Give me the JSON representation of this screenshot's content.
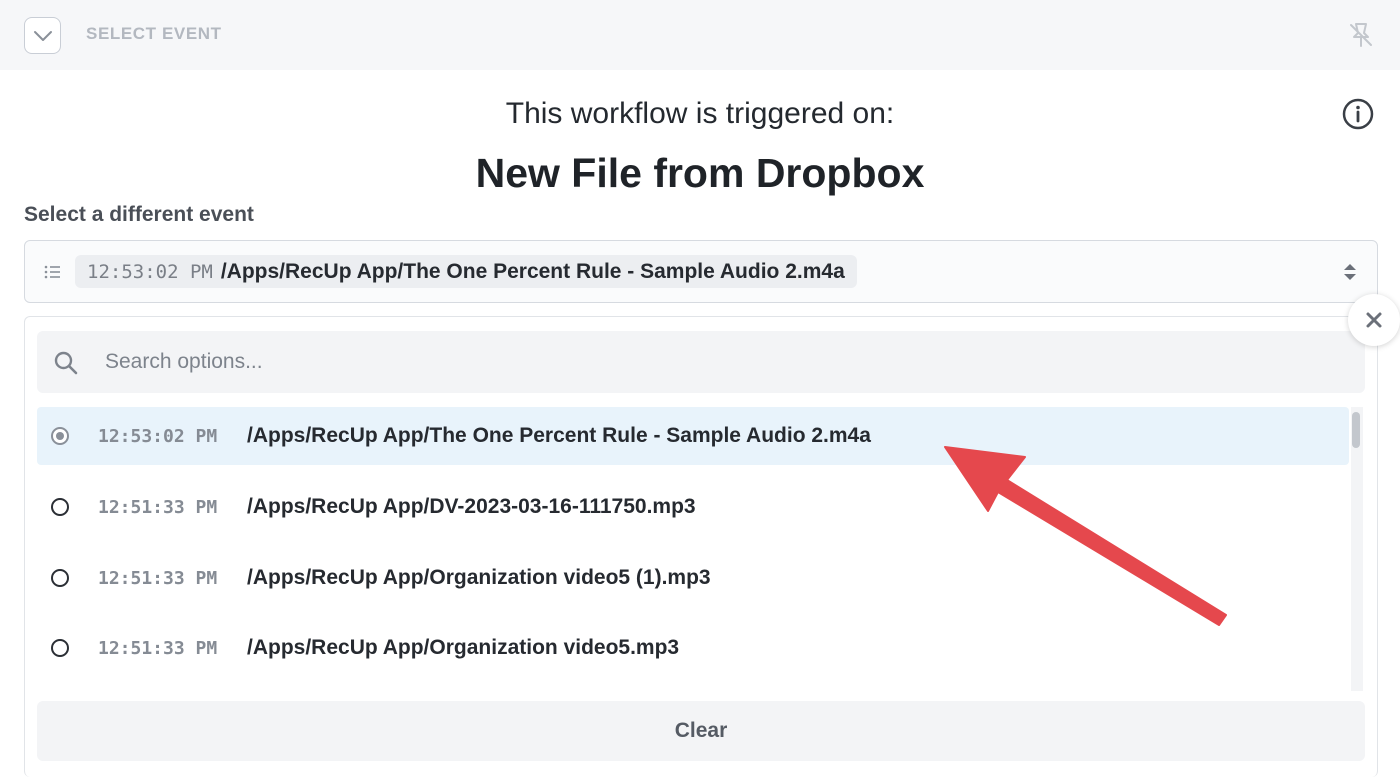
{
  "topbar": {
    "title": "SELECT EVENT",
    "collapse_icon": "chevron-down-icon",
    "pin_icon": "unpin-icon"
  },
  "header": {
    "subtitle": "This workflow is triggered on:",
    "title": "New File from Dropbox",
    "info_icon": "info-icon"
  },
  "select": {
    "label": "Select a different event",
    "selected_time": "12:53:02 PM",
    "selected_path": "/Apps/RecUp App/The One Percent Rule - Sample Audio 2.m4a"
  },
  "dropdown": {
    "search_placeholder": "Search options...",
    "options": [
      {
        "time": "12:53:02 PM",
        "path": "/Apps/RecUp App/The One Percent Rule - Sample Audio 2.m4a",
        "selected": true
      },
      {
        "time": "12:51:33 PM",
        "path": "/Apps/RecUp App/DV-2023-03-16-111750.mp3",
        "selected": false
      },
      {
        "time": "12:51:33 PM",
        "path": "/Apps/RecUp App/Organization video5 (1).mp3",
        "selected": false
      },
      {
        "time": "12:51:33 PM",
        "path": "/Apps/RecUp App/Organization video5.mp3",
        "selected": false
      }
    ],
    "clear_label": "Clear"
  },
  "annotation": {
    "arrow_color": "#e5484d"
  }
}
